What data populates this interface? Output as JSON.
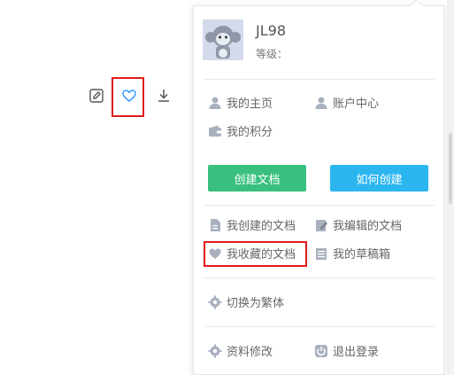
{
  "colors": {
    "accent_green": "#39c07f",
    "accent_blue": "#2cb6f0",
    "highlight_red": "#e11b1b",
    "icon_gray": "#a9b1bf"
  },
  "toolbar": {
    "icons": [
      "edit-icon",
      "heart-icon",
      "download-icon"
    ]
  },
  "user": {
    "name": "JL98",
    "level_label": "等级："
  },
  "menu": {
    "homepage": "我的主页",
    "account_center": "账户中心",
    "points": "我的积分",
    "create_doc_button": "创建文档",
    "how_to_create_button": "如何创建",
    "my_created_docs": "我创建的文档",
    "my_edited_docs": "我编辑的文档",
    "my_favorite_docs": "我收藏的文档",
    "my_drafts": "我的草稿箱",
    "switch_traditional": "切换为繁体",
    "edit_profile": "资料修改",
    "logout": "退出登录"
  }
}
